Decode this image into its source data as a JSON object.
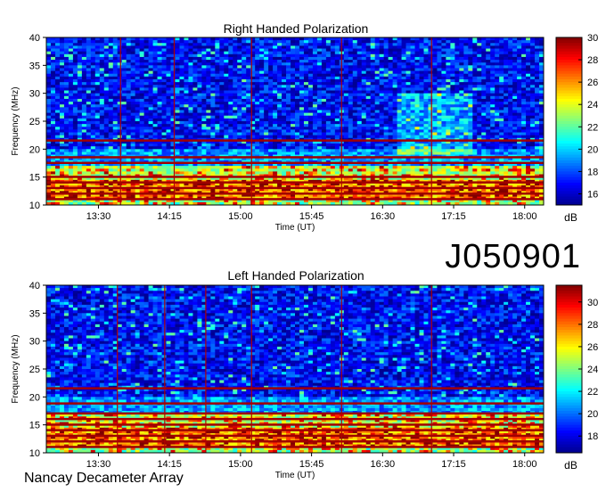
{
  "observation_id": "J050901",
  "footer": "Nancay Decameter Array",
  "chart_data": [
    {
      "type": "heatmap",
      "title": "Right Handed Polarization",
      "xlabel": "Time (UT)",
      "ylabel": "Frequency (MHz)",
      "xlim": [
        "12:57",
        "18:12"
      ],
      "x_ticks": [
        "13:30",
        "14:15",
        "15:00",
        "15:45",
        "16:30",
        "17:15",
        "18:00"
      ],
      "ylim": [
        10,
        40
      ],
      "y_ticks": [
        10,
        15,
        20,
        25,
        30,
        35,
        40
      ],
      "colorbar": {
        "label": "dB",
        "ticks": [
          16,
          18,
          20,
          22,
          24,
          26,
          28,
          30
        ],
        "range": [
          15,
          30
        ]
      },
      "vertical_markers": [
        "13:44",
        "14:18",
        "15:07",
        "16:04",
        "17:01"
      ],
      "horizontal_bands_mhz": [
        21.5,
        18.5,
        17.5,
        15,
        14,
        13,
        12,
        11
      ],
      "colorscale": [
        "#00008f",
        "#0000ff",
        "#0080ff",
        "#00ffff",
        "#80ff80",
        "#ffff00",
        "#ff8000",
        "#ff0000",
        "#800000"
      ]
    },
    {
      "type": "heatmap",
      "title": "Left Handed Polarization",
      "xlabel": "Time (UT)",
      "ylabel": "Frequency (MHz)",
      "xlim": [
        "12:57",
        "18:12"
      ],
      "x_ticks": [
        "13:30",
        "14:15",
        "15:00",
        "15:45",
        "16:30",
        "17:15",
        "18:00"
      ],
      "ylim": [
        10,
        40
      ],
      "y_ticks": [
        10,
        15,
        20,
        25,
        30,
        35,
        40
      ],
      "colorbar": {
        "label": "dB",
        "ticks": [
          18,
          20,
          22,
          24,
          26,
          28,
          30
        ],
        "range": [
          16.5,
          31.5
        ]
      },
      "vertical_markers": [
        "13:42",
        "14:12",
        "14:38",
        "15:07",
        "16:04",
        "17:01"
      ],
      "horizontal_bands_mhz": [
        21.5,
        18.8,
        17,
        16,
        15,
        14,
        13,
        12,
        11
      ],
      "colorscale": [
        "#00008f",
        "#0000ff",
        "#0080ff",
        "#00ffff",
        "#80ff80",
        "#ffff00",
        "#ff8000",
        "#ff0000",
        "#800000"
      ]
    }
  ]
}
